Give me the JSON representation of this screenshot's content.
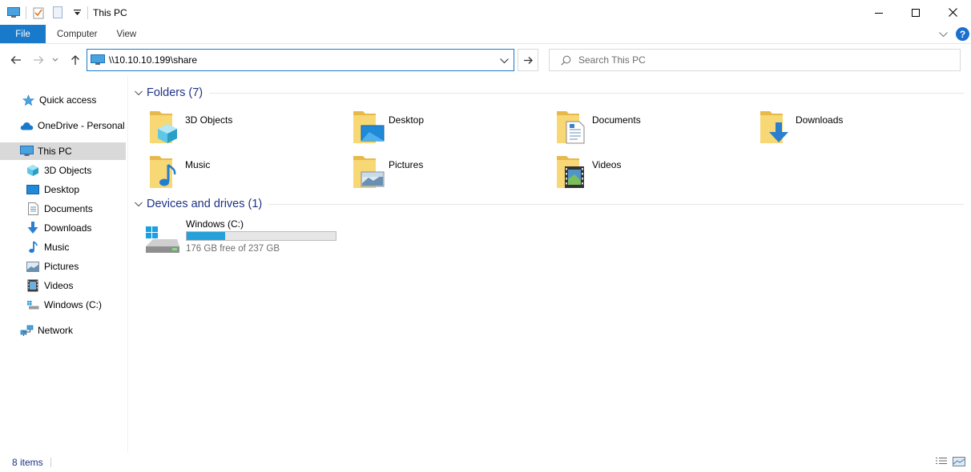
{
  "window": {
    "title": "This PC"
  },
  "ribbon": {
    "tabs": [
      "File",
      "Computer",
      "View"
    ]
  },
  "address": {
    "path": "\\\\10.10.10.199\\share",
    "search_placeholder": "Search This PC"
  },
  "sidebar": {
    "items": [
      {
        "label": "Quick access",
        "icon": "star-icon"
      },
      {
        "label": "OneDrive - Personal",
        "icon": "cloud-icon"
      },
      {
        "label": "This PC",
        "icon": "computer-icon",
        "selected": true
      },
      {
        "label": "3D Objects",
        "icon": "cube-icon"
      },
      {
        "label": "Desktop",
        "icon": "desktop-icon"
      },
      {
        "label": "Documents",
        "icon": "document-icon"
      },
      {
        "label": "Downloads",
        "icon": "download-icon"
      },
      {
        "label": "Music",
        "icon": "music-icon"
      },
      {
        "label": "Pictures",
        "icon": "pictures-icon"
      },
      {
        "label": "Videos",
        "icon": "videos-icon"
      },
      {
        "label": "Windows (C:)",
        "icon": "drive-icon"
      },
      {
        "label": "Network",
        "icon": "network-icon"
      }
    ]
  },
  "content": {
    "folders_header": "Folders (7)",
    "folders": [
      {
        "label": "3D Objects",
        "icon": "cube-folder-icon"
      },
      {
        "label": "Desktop",
        "icon": "desktop-folder-icon"
      },
      {
        "label": "Documents",
        "icon": "documents-folder-icon"
      },
      {
        "label": "Downloads",
        "icon": "downloads-folder-icon"
      },
      {
        "label": "Music",
        "icon": "music-folder-icon"
      },
      {
        "label": "Pictures",
        "icon": "pictures-folder-icon"
      },
      {
        "label": "Videos",
        "icon": "videos-folder-icon"
      }
    ],
    "drives_header": "Devices and drives (1)",
    "drives": [
      {
        "label": "Windows (C:)",
        "free_text": "176 GB free of 237 GB",
        "used_fraction": 0.257
      }
    ]
  },
  "status": {
    "item_count": "8 items"
  },
  "colors": {
    "accent": "#1979ca",
    "header_text": "#1e3287",
    "selected_bg": "#d9d9d9",
    "drive_fill": "#26a0da",
    "folder_yellow": "#f8d775"
  }
}
